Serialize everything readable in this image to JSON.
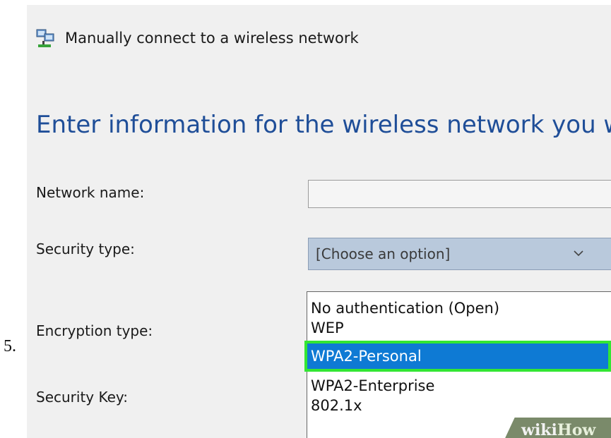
{
  "step_number": "5.",
  "window": {
    "title": "Manually connect to a wireless network",
    "title_icon": "network-icon",
    "instruction": "Enter information for the wireless network you w"
  },
  "form": {
    "network_name_label": "Network name:",
    "network_name_value": "",
    "security_type_label": "Security type:",
    "security_type_selected": "[Choose an option]",
    "encryption_type_label": "Encryption type:",
    "security_key_label": "Security Key:"
  },
  "dropdown": {
    "options": [
      "No authentication (Open)",
      "WEP",
      "WPA2-Personal",
      "WPA2-Enterprise",
      "802.1x"
    ],
    "highlighted": "WPA2-Personal"
  },
  "watermark": {
    "part1": "wiki",
    "part2": "How"
  },
  "colors": {
    "heading": "#1f4e98",
    "selection": "#0e7ad4",
    "highlight_box": "#33e633"
  }
}
